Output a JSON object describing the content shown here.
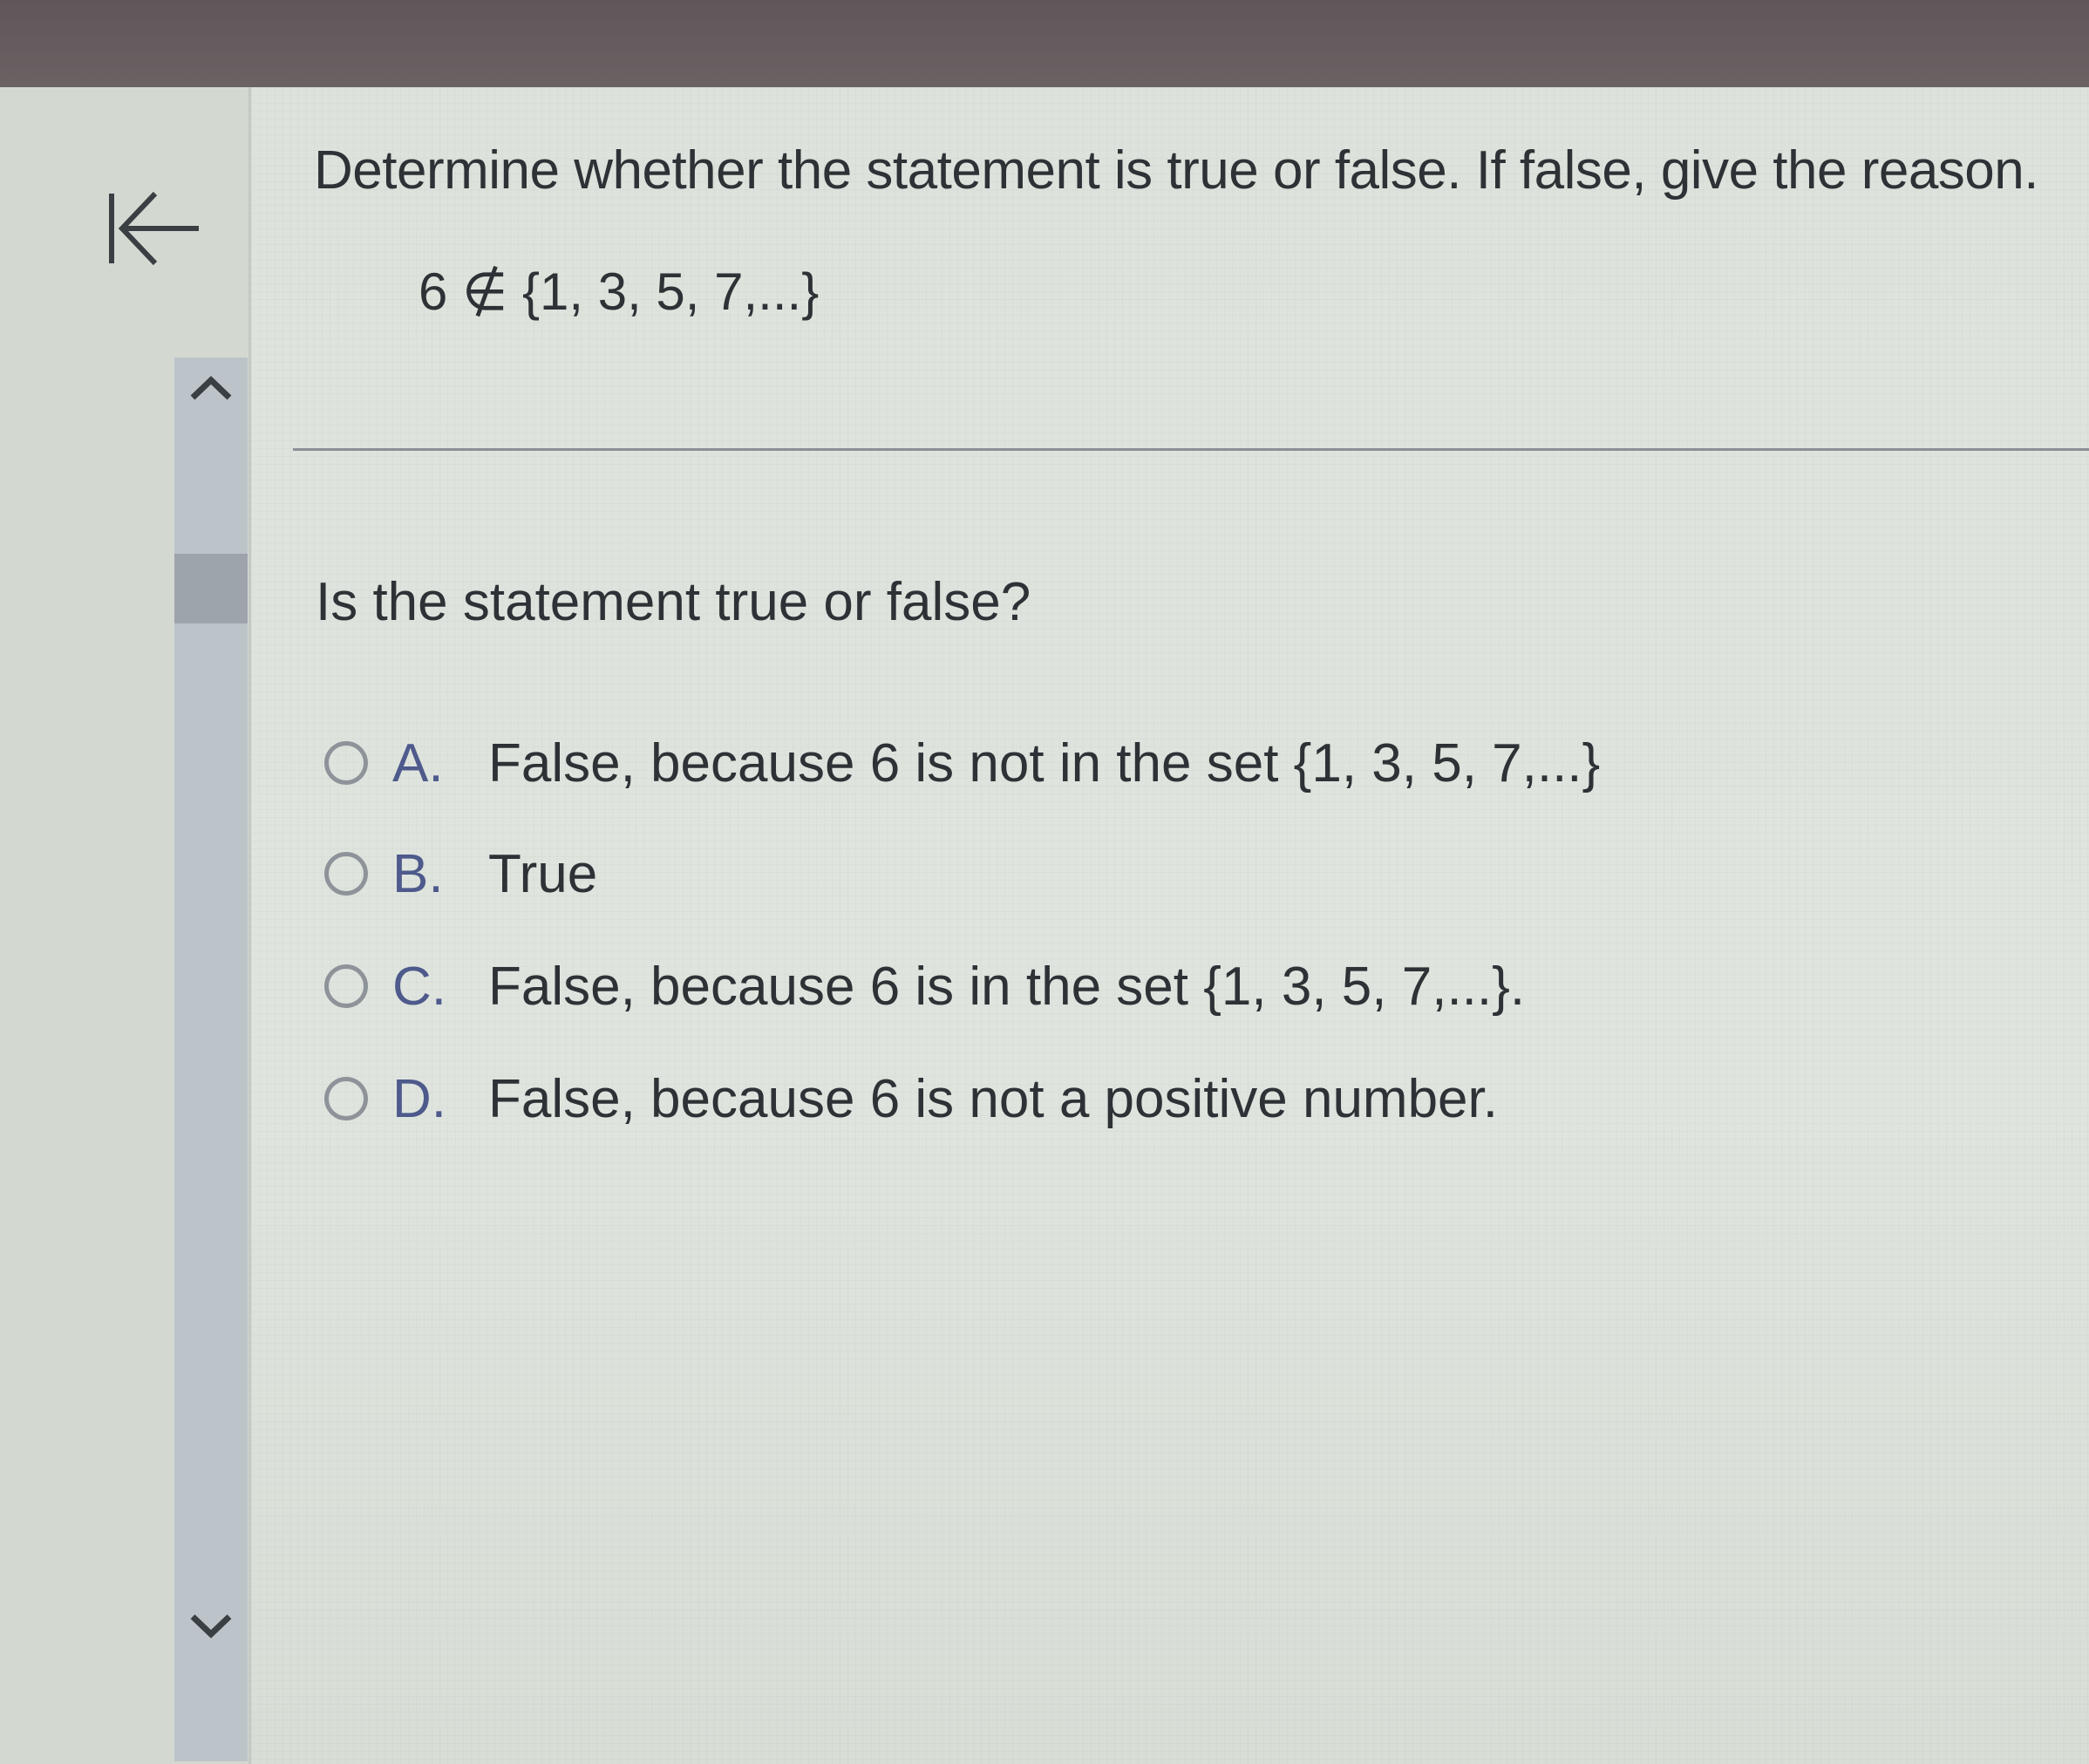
{
  "problem": {
    "instruction": "Determine whether the statement is true or false. If false, give the reason.",
    "statement": "6 ∉ {1, 3, 5, 7,...}"
  },
  "question": {
    "prompt": "Is the statement true or false?",
    "options": [
      {
        "letter": "A.",
        "text": "False, because 6 is not in the set {1, 3, 5, 7,...}"
      },
      {
        "letter": "B.",
        "text": "True"
      },
      {
        "letter": "C.",
        "text": "False, because 6 is in the set {1, 3, 5, 7,...}."
      },
      {
        "letter": "D.",
        "text": "False, because 6 is not a positive number."
      }
    ]
  },
  "icons": {
    "back": "first-page-arrow-icon",
    "scroll_up": "chevron-up-icon",
    "scroll_down": "chevron-down-icon"
  }
}
